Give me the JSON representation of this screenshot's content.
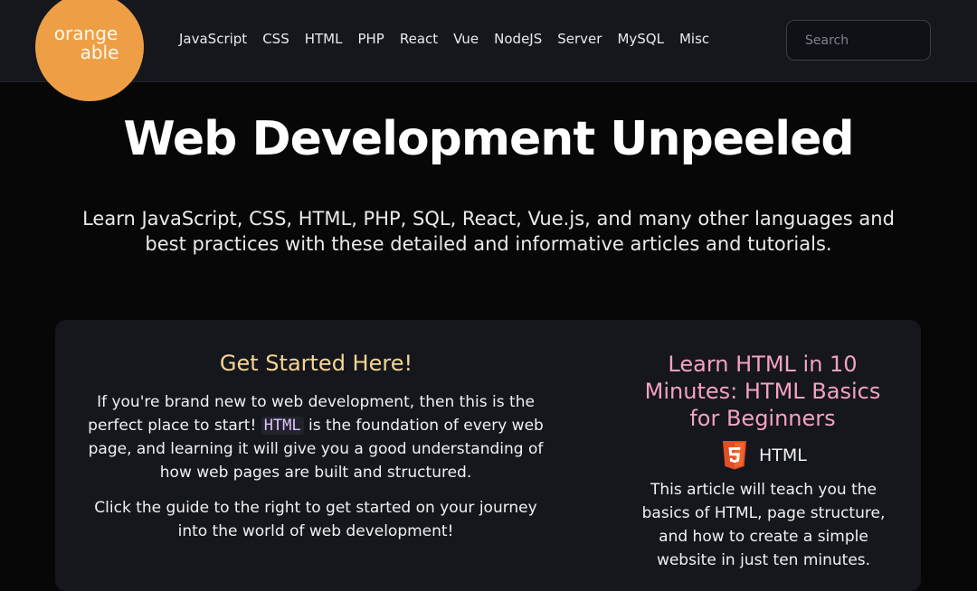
{
  "header": {
    "logo": {
      "line1": "orange",
      "line2": "able"
    },
    "nav": [
      "JavaScript",
      "CSS",
      "HTML",
      "PHP",
      "React",
      "Vue",
      "NodeJS",
      "Server",
      "MySQL",
      "Misc"
    ],
    "search": {
      "placeholder": "Search",
      "value": ""
    }
  },
  "hero": {
    "title": "Web Development Unpeeled",
    "subtitle": "Learn JavaScript, CSS, HTML, PHP, SQL, React, Vue.js, and many other languages and best practices with these detailed and informative articles and tutorials."
  },
  "get_started": {
    "title": "Get Started Here!",
    "para1_before": "If you're brand new to web development, then this is the perfect place to start!",
    "para1_code": "HTML",
    "para1_after": "is the foundation of every web page, and learning it will give you a good understanding of how web pages are built and structured.",
    "para2": "Click the guide to the right to get started on your journey into the world of web development!"
  },
  "featured_article": {
    "title": "Learn HTML in 10 Minutes: HTML Basics for Beginners",
    "category_icon": "html5-icon",
    "category": "HTML",
    "description": "This article will teach you the basics of HTML, page structure, and how to create a simple website in just ten minutes."
  },
  "colors": {
    "page_background": "#070707",
    "header_background": "#15171d",
    "logo_orange": "#ee9f46",
    "get_started_title": "#f5d690",
    "article_title": "#f4a2c2",
    "inline_code": "#dcc4ff",
    "html5_orange": "#e44d26"
  }
}
